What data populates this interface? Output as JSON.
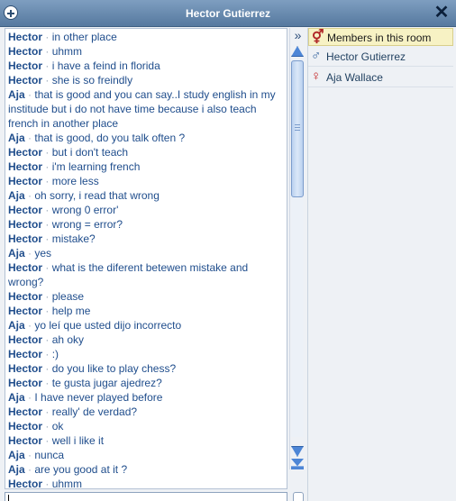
{
  "window": {
    "title": "Hector Gutierrez"
  },
  "members": {
    "header_label": "Members in this room",
    "items": [
      {
        "name": "Hector Gutierrez",
        "gender": "male"
      },
      {
        "name": "Aja Wallace",
        "gender": "female"
      }
    ]
  },
  "chat": {
    "separator": "·",
    "messages": [
      {
        "speaker": "Hector",
        "text": "in other place"
      },
      {
        "speaker": "Hector",
        "text": "uhmm"
      },
      {
        "speaker": "Hector",
        "text": "i have a feind in florida"
      },
      {
        "speaker": "Hector",
        "text": "she is so freindly"
      },
      {
        "speaker": "Aja",
        "text": "that is good and you can say..I study english in my institude but i do not have time because i also teach french in another place"
      },
      {
        "speaker": "Aja",
        "text": "that is good, do you talk often ?"
      },
      {
        "speaker": "Hector",
        "text": "but i don't teach"
      },
      {
        "speaker": "Hector",
        "text": "i'm learning french"
      },
      {
        "speaker": "Hector",
        "text": "more less"
      },
      {
        "speaker": "Aja",
        "text": "oh sorry, i read that wrong"
      },
      {
        "speaker": "Hector",
        "text": "wrong 0 error'"
      },
      {
        "speaker": "Hector",
        "text": "wrong = error?"
      },
      {
        "speaker": "Hector",
        "text": "mistake?"
      },
      {
        "speaker": "Aja",
        "text": "yes"
      },
      {
        "speaker": "Hector",
        "text": "what is the diferent betewen mistake and wrong?"
      },
      {
        "speaker": "Hector",
        "text": "please"
      },
      {
        "speaker": "Hector",
        "text": "help me"
      },
      {
        "speaker": "Aja",
        "text": "yo leí que usted dijo incorrecto"
      },
      {
        "speaker": "Hector",
        "text": "ah oky"
      },
      {
        "speaker": "Hector",
        "text": ":)"
      },
      {
        "speaker": "Hector",
        "text": "do you like to play chess?"
      },
      {
        "speaker": "Hector",
        "text": "te gusta jugar ajedrez?"
      },
      {
        "speaker": "Aja",
        "text": "I have never played before"
      },
      {
        "speaker": "Hector",
        "text": "really' de verdad?"
      },
      {
        "speaker": "Hector",
        "text": "ok"
      },
      {
        "speaker": "Hector",
        "text": "well i like it"
      },
      {
        "speaker": "Aja",
        "text": "nunca"
      },
      {
        "speaker": "Aja",
        "text": "are you good at it ?"
      },
      {
        "speaker": "Hector",
        "text": "uhmm"
      }
    ]
  },
  "input": {
    "value": ""
  },
  "colors": {
    "speaker": "#1f4d8c",
    "titlebar": "#56799f",
    "members_header": "#f7f2c4"
  },
  "icons": [
    "chat-window-icon",
    "close-icon",
    "collapse-panel-icon",
    "members-gender-icon",
    "male-icon",
    "female-icon",
    "scroll-up-icon",
    "scroll-down-icon",
    "scroll-end-icon"
  ]
}
